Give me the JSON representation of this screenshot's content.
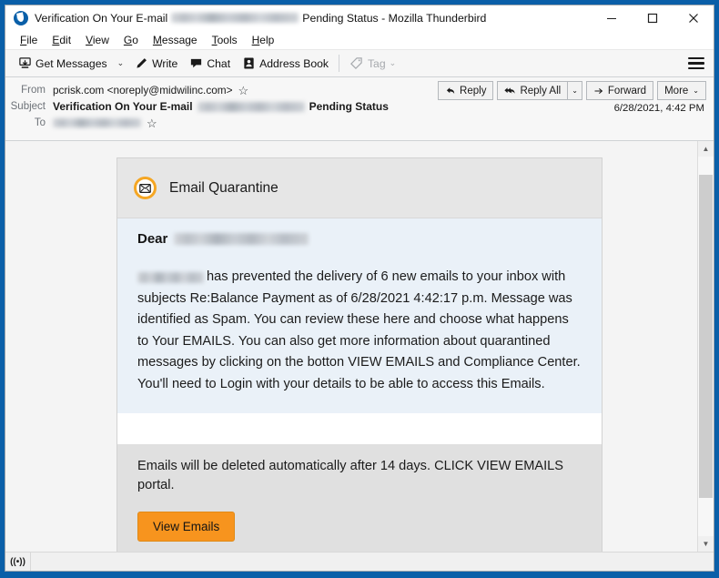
{
  "window": {
    "title_prefix": "Verification On Your E-mail",
    "title_suffix": "Pending Status - Mozilla Thunderbird",
    "app_logo_name": "thunderbird-logo",
    "controls": {
      "minimize": "Minimize",
      "maximize": "Maximize",
      "close": "Close"
    }
  },
  "menu": {
    "items": [
      {
        "access": "F",
        "rest": "ile"
      },
      {
        "access": "E",
        "rest": "dit"
      },
      {
        "access": "V",
        "rest": "iew"
      },
      {
        "access": "G",
        "rest": "o"
      },
      {
        "access": "M",
        "rest": "essage"
      },
      {
        "access": "T",
        "rest": "ools"
      },
      {
        "access": "H",
        "rest": "elp"
      }
    ]
  },
  "toolbar": {
    "get_messages": "Get Messages",
    "write": "Write",
    "chat": "Chat",
    "address_book": "Address Book",
    "tag": "Tag",
    "caret": "⌄",
    "app_menu_name": "hamburger-menu"
  },
  "message_header": {
    "from_label": "From",
    "from_value": "pcrisk.com <noreply@midwilinc.com>",
    "subject_label": "Subject",
    "subject_prefix": "Verification On Your E-mail",
    "subject_suffix": "Pending Status",
    "to_label": "To",
    "to_value_redacted": true,
    "date": "6/28/2021, 4:42 PM",
    "star_glyph": "☆",
    "actions": {
      "reply": "Reply",
      "reply_all": "Reply All",
      "forward": "Forward",
      "more": "More",
      "caret": "⌄"
    }
  },
  "email": {
    "card_title": "Email Quarantine",
    "card_icon_name": "quarantine-envelope-icon",
    "greeting_label": "Dear",
    "greeting_redacted": true,
    "body_paragraph": "has prevented the delivery of 6 new emails to your inbox with subjects Re:Balance Payment as of 6/28/2021 4:42:17 p.m. Message was identified as Spam. You can review these here and choose what happens to Your EMAILS. You can also get more information about quarantined messages by clicking on the botton VIEW EMAILS and Compliance Center. You'll need to Login with your details to be able to access this Emails.",
    "footer_text": "Emails will be deleted automatically after 14 days. CLICK VIEW EMAILS portal.",
    "cta_label": "View Emails",
    "cta_color": "#f7941e",
    "accent_color": "#f5a623",
    "body_bg": "#eaf1f8",
    "header_bg": "#e6e6e6",
    "footer_bg": "#e0e0e0"
  },
  "scrollbar": {
    "up_glyph": "▲",
    "down_glyph": "▼"
  },
  "status_bar": {
    "connection_icon": "((•))",
    "message": ""
  }
}
